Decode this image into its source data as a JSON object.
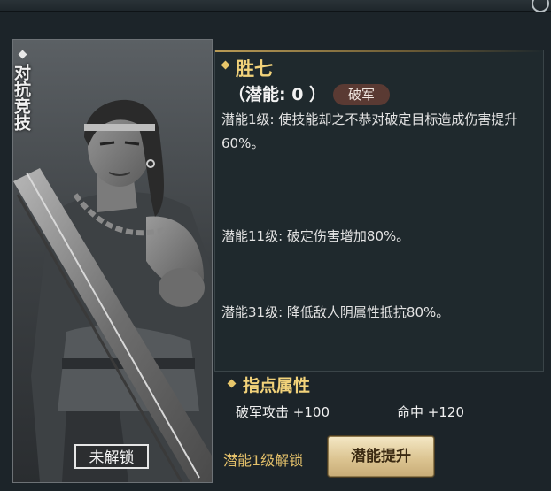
{
  "card": {
    "mode_label": "对抗竞技",
    "lock_status": "未解锁"
  },
  "hero": {
    "name": "胜七",
    "potential_line": "（潜能: 0 ）",
    "class_tag": "破军"
  },
  "potentials": [
    "潜能1级: 使技能却之不恭对破定目标造成伤害提升60%。",
    "潜能11级: 破定伤害增加80%。",
    "潜能31级: 降低敌人阴属性抵抗80%。"
  ],
  "attributes": {
    "title": "指点属性",
    "stats": [
      {
        "label": "破军攻击",
        "value": "+100"
      },
      {
        "label": "命中",
        "value": "+120"
      }
    ]
  },
  "footer": {
    "unlock_text": "潜能1级解锁",
    "upgrade_label": "潜能提升"
  },
  "icons": {
    "section_marker": "diamond-icon",
    "corner": "ring-icon"
  },
  "colors": {
    "gold": "#f2d27a",
    "panel_bg": "#1f292d",
    "tag_bg": "#5a3a33"
  }
}
